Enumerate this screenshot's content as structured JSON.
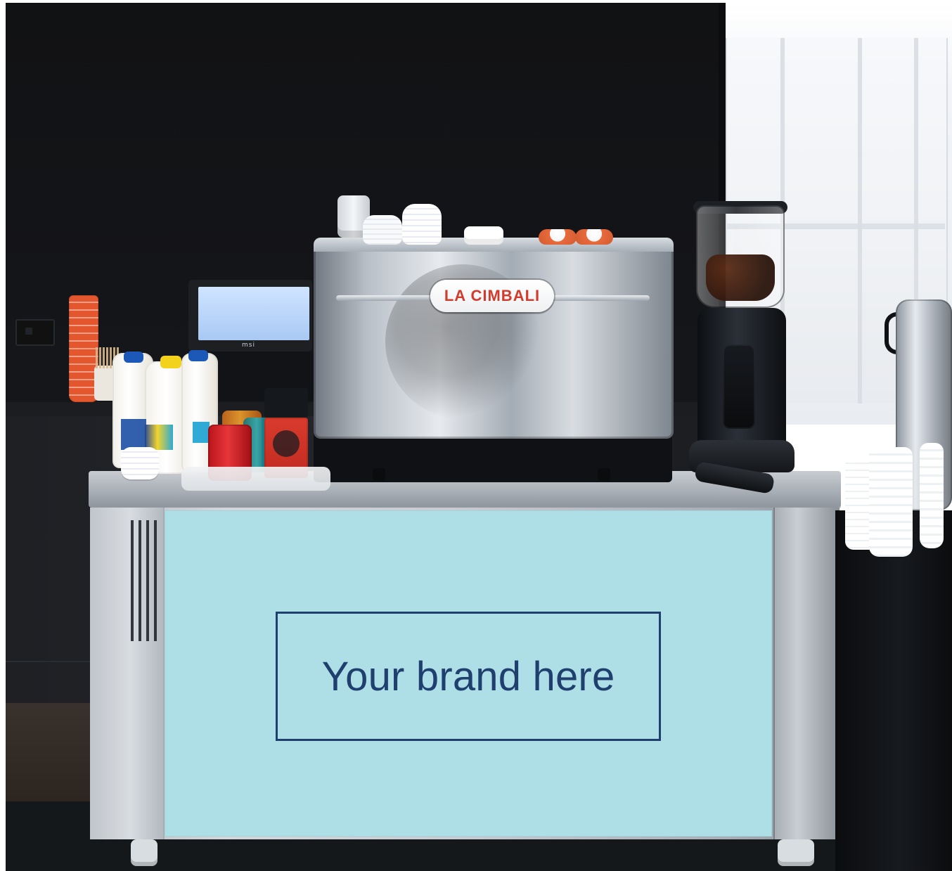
{
  "scene": {
    "brand_panel_text": "Your brand here",
    "machine_badge_text": "LA CIMBALI",
    "laptop_badge_text": "msi"
  },
  "colors": {
    "brand_panel_bg": "#aedfe6",
    "brand_ink": "#1f3f6e",
    "badge_red": "#d23b2c",
    "cup_orange": "#e4572e"
  },
  "icons": {
    "decor": [
      "coffee-machine-icon",
      "grinder-icon",
      "milk-bottle-icon",
      "cup-stack-icon",
      "laptop-icon",
      "urn-icon"
    ]
  }
}
